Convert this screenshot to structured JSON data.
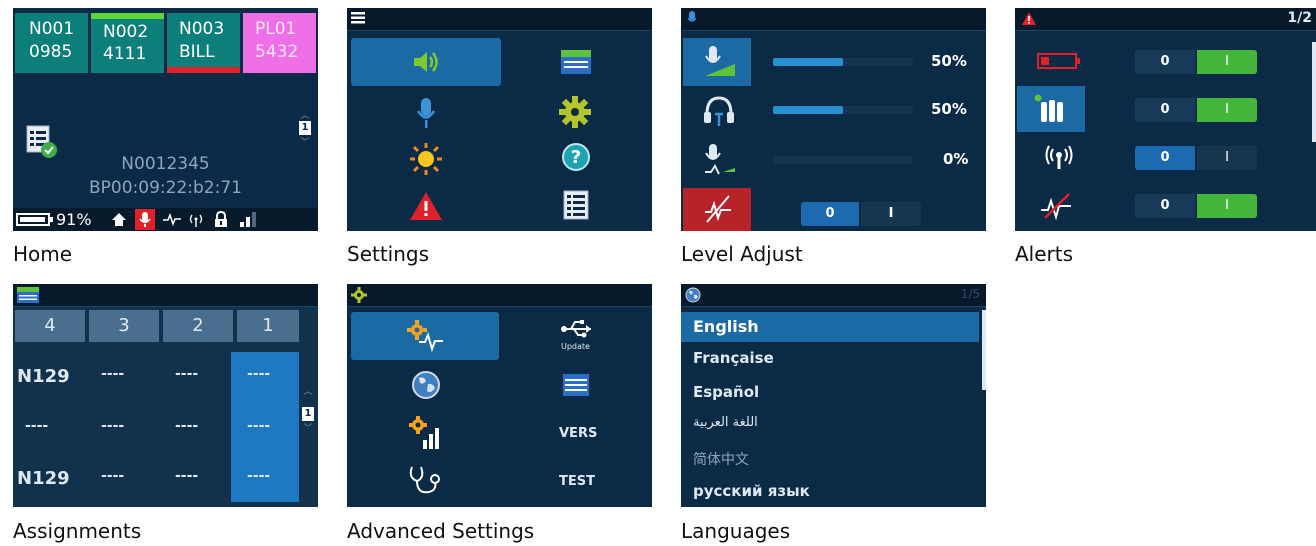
{
  "captions": {
    "home": "Home",
    "settings": "Settings",
    "level_adjust": "Level Adjust",
    "alerts": "Alerts",
    "assignments": "Assignments",
    "advanced": "Advanced Settings",
    "languages": "Languages"
  },
  "home": {
    "tiles": [
      {
        "line1": "N001",
        "line2": "0985",
        "color": "#0d7f7a"
      },
      {
        "line1": "N002",
        "line2": "4111",
        "color": "#0d7f7a",
        "indicator": "#5fd43a"
      },
      {
        "line1": "N003",
        "line2": "BILL",
        "color": "#0d7f7a",
        "indicator": "#e0202a"
      },
      {
        "line1": "PL01",
        "line2": "5432",
        "color": "#ee6fe6"
      }
    ],
    "page_indicator": "1",
    "device_id": "N0012345",
    "mac": "BP00:09:22:b2:71",
    "battery": "91%"
  },
  "settings": {
    "icons": [
      "speaker-icon",
      "assignments-icon",
      "mic-icon",
      "gear-icon",
      "brightness-icon",
      "help-icon",
      "alert-icon",
      "list-icon"
    ]
  },
  "level_adjust": {
    "rows": [
      {
        "icon": "mic-level-icon",
        "value": 50,
        "label": "50%"
      },
      {
        "icon": "headset-icon",
        "value": 50,
        "label": "50%"
      },
      {
        "icon": "sidetone-icon",
        "value": 0,
        "label": "0%"
      }
    ],
    "toggle_off": "0",
    "toggle_on": "I"
  },
  "alerts": {
    "page": "1/2",
    "toggles": [
      {
        "off": "0",
        "on": "I"
      },
      {
        "off": "0",
        "on": "I"
      },
      {
        "off": "0",
        "on": "I"
      },
      {
        "off": "0",
        "on": "I"
      }
    ]
  },
  "assignments": {
    "headers": [
      "4",
      "3",
      "2",
      "1"
    ],
    "rows": [
      [
        "N129",
        "----",
        "----",
        "----"
      ],
      [
        "----",
        "----",
        "----",
        "----"
      ],
      [
        "N129",
        "----",
        "----",
        "----"
      ]
    ],
    "scroll_indicator": "1"
  },
  "advanced": {
    "right_labels": [
      "Update",
      "",
      "VERS",
      "TEST"
    ]
  },
  "languages": {
    "page": "1/5",
    "items": [
      "English",
      "Française",
      "Español",
      "اللغة العربية",
      "简体中文",
      "русский язык"
    ]
  }
}
